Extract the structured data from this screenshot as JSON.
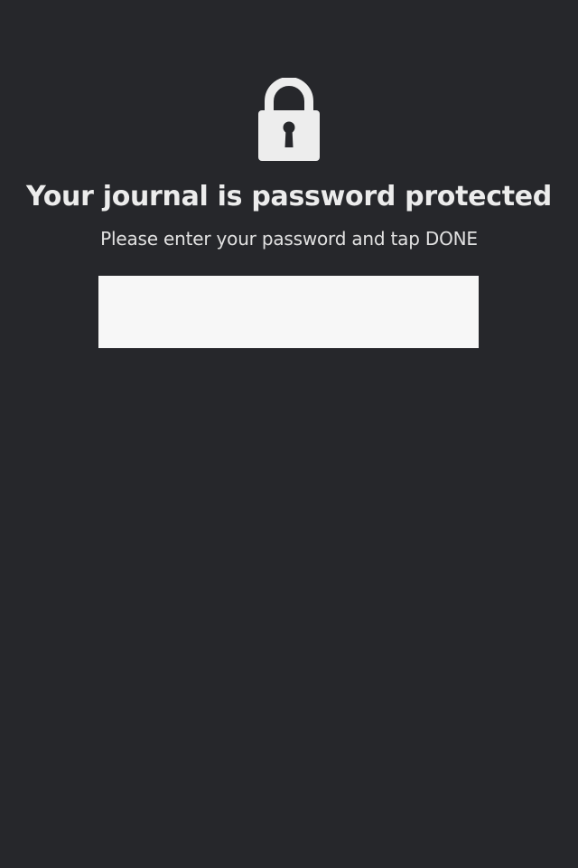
{
  "lock_screen": {
    "icon": "lock-icon",
    "title": "Your journal is password protected",
    "instruction": "Please enter your password and tap DONE",
    "password": {
      "value": "",
      "placeholder": ""
    }
  },
  "colors": {
    "background": "#26272b",
    "text": "#ececec",
    "field_background": "#f7f7f7"
  }
}
